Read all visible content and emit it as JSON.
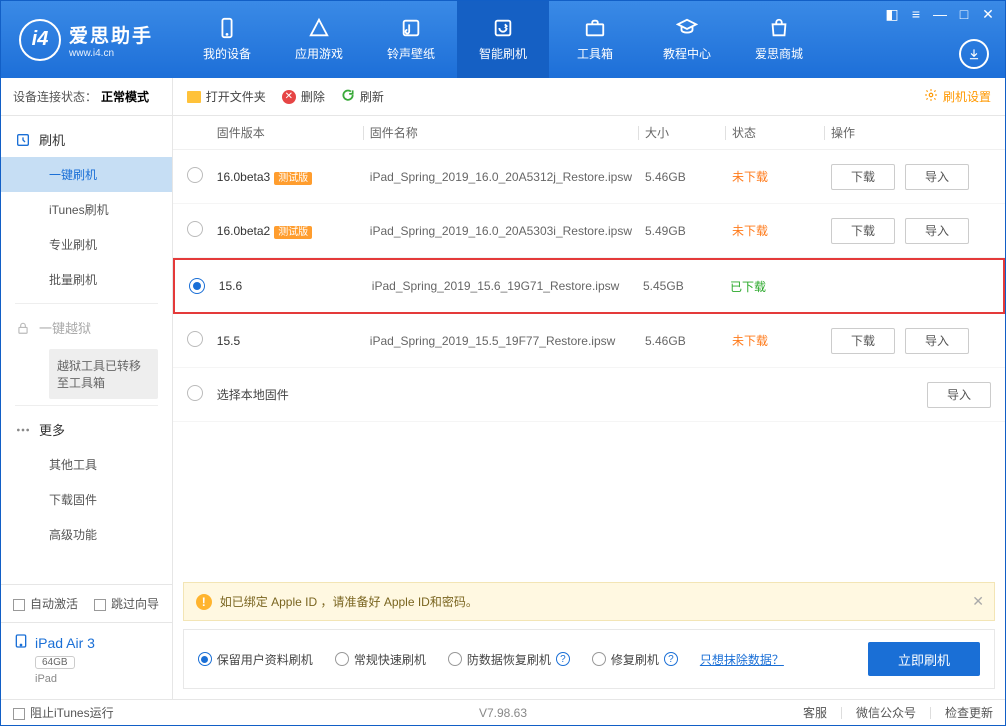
{
  "app": {
    "name": "爱思助手",
    "url": "www.i4.cn"
  },
  "nav": {
    "items": [
      {
        "label": "我的设备"
      },
      {
        "label": "应用游戏"
      },
      {
        "label": "铃声壁纸"
      },
      {
        "label": "智能刷机"
      },
      {
        "label": "工具箱"
      },
      {
        "label": "教程中心"
      },
      {
        "label": "爱思商城"
      }
    ]
  },
  "sidebar": {
    "conn_label": "设备连接状态：",
    "conn_value": "正常模式",
    "groups": {
      "flash": "刷机",
      "jailbreak": "一键越狱",
      "more": "更多"
    },
    "flash_items": [
      "一键刷机",
      "iTunes刷机",
      "专业刷机",
      "批量刷机"
    ],
    "jailbreak_notice": "越狱工具已转移至工具箱",
    "more_items": [
      "其他工具",
      "下载固件",
      "高级功能"
    ],
    "auto_activate": "自动激活",
    "skip_wizard": "跳过向导",
    "device": {
      "name": "iPad Air 3",
      "capacity": "64GB",
      "type": "iPad"
    }
  },
  "toolbar": {
    "open_folder": "打开文件夹",
    "delete": "删除",
    "refresh": "刷新",
    "settings": "刷机设置"
  },
  "table": {
    "headers": {
      "version": "固件版本",
      "name": "固件名称",
      "size": "大小",
      "status": "状态",
      "ops": "操作"
    },
    "rows": [
      {
        "version": "16.0beta3",
        "beta": "测试版",
        "name": "iPad_Spring_2019_16.0_20A5312j_Restore.ipsw",
        "size": "5.46GB",
        "status": "未下载",
        "status_class": "orange",
        "dl": "下载",
        "imp": "导入",
        "selected": false
      },
      {
        "version": "16.0beta2",
        "beta": "测试版",
        "name": "iPad_Spring_2019_16.0_20A5303i_Restore.ipsw",
        "size": "5.49GB",
        "status": "未下载",
        "status_class": "orange",
        "dl": "下载",
        "imp": "导入",
        "selected": false
      },
      {
        "version": "15.6",
        "beta": "",
        "name": "iPad_Spring_2019_15.6_19G71_Restore.ipsw",
        "size": "5.45GB",
        "status": "已下载",
        "status_class": "green",
        "selected": true
      },
      {
        "version": "15.5",
        "beta": "",
        "name": "iPad_Spring_2019_15.5_19F77_Restore.ipsw",
        "size": "5.46GB",
        "status": "未下载",
        "status_class": "orange",
        "dl": "下载",
        "imp": "导入",
        "selected": false
      }
    ],
    "local_row": {
      "label": "选择本地固件",
      "imp": "导入"
    }
  },
  "alert": "如已绑定 Apple ID ，请准备好 Apple ID和密码。",
  "flash_options": {
    "keep_data": "保留用户资料刷机",
    "normal": "常规快速刷机",
    "recovery": "防数据恢复刷机",
    "repair": "修复刷机",
    "erase_link": "只想抹除数据？",
    "flash_now": "立即刷机"
  },
  "footer": {
    "block_itunes": "阻止iTunes运行",
    "version": "V7.98.63",
    "support": "客服",
    "wechat": "微信公众号",
    "update": "检查更新"
  }
}
